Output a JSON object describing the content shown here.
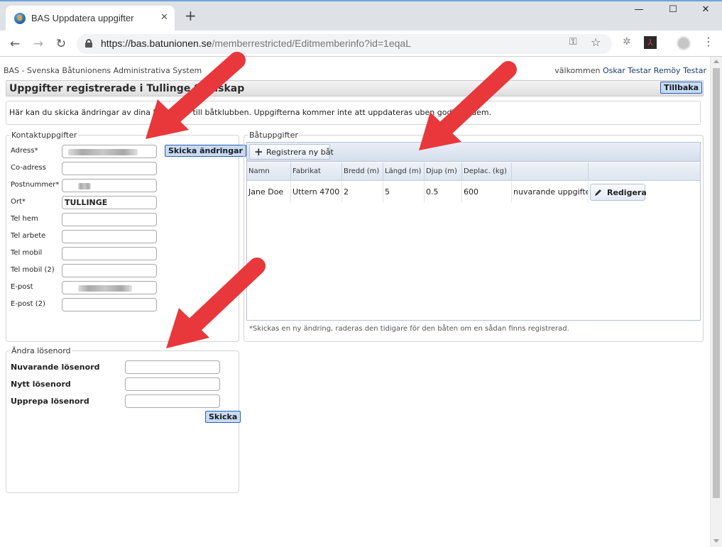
{
  "browser": {
    "tab_title": "BAS Uppdatera uppgifter",
    "tab_close": "✕",
    "new_tab": "+",
    "url_host": "https://bas.batunionen.se",
    "url_path": "/memberrestricted/Editmemberinfo?id=1eqaL",
    "win_minimize": "—",
    "win_maximize": "☐",
    "win_close": "✕"
  },
  "header": {
    "app_name": "BAS - Svenska Båtunionens Administrativa System",
    "welcome_prefix": "välkommen ",
    "user_name": "Oskar Testar Remöy Testar"
  },
  "title_bar": {
    "title": "Uppgifter registrerade i Tullinge Se   llskap",
    "back_label": "Tillbaka"
  },
  "info": {
    "text": "Här kan du skicka ändringar av dina ko          pgifter till båtklubben. Uppgifterna kommer inte att uppdateras            uben godkänt dem."
  },
  "contact": {
    "legend": "Kontaktuppgifter",
    "send_label": "Skicka ändringar",
    "fields": [
      {
        "label": "Adress*",
        "value": ""
      },
      {
        "label": "Co-adress",
        "value": ""
      },
      {
        "label": "Postnummer*",
        "value": ""
      },
      {
        "label": "Ort*",
        "value": "TULLINGE"
      },
      {
        "label": "Tel hem",
        "value": ""
      },
      {
        "label": "Tel arbete",
        "value": ""
      },
      {
        "label": "Tel mobil",
        "value": ""
      },
      {
        "label": "Tel mobil (2)",
        "value": ""
      },
      {
        "label": "E-post",
        "value": ""
      },
      {
        "label": "E-post (2)",
        "value": ""
      }
    ]
  },
  "password": {
    "legend": "Ändra lösenord",
    "current_label": "Nuvarande lösenord",
    "new_label": "Nytt lösenord",
    "repeat_label": "Upprepa lösenord",
    "submit_label": "Skicka"
  },
  "boats": {
    "legend": "Båtuppgifter",
    "add_label": "Registrera ny båt",
    "columns": [
      "Namn",
      "Fabrikat",
      "Bredd (m)",
      "Längd (m)",
      "Djup (m)",
      "Deplac. (kg)",
      ""
    ],
    "rows": [
      {
        "name": "Jane Doe",
        "make": "Uttern 4700",
        "width": "2",
        "length": "5",
        "depth": "0.5",
        "displacement": "600",
        "status": "nuvarande uppgifter"
      }
    ],
    "edit_label": "Redigera",
    "note": "*Skickas en ny ändring, raderas den tidigare för den båten om en sådan finns registrerad."
  },
  "colors": {
    "button_blue": "#c7dbf6",
    "arrow_red": "#e8383b"
  }
}
